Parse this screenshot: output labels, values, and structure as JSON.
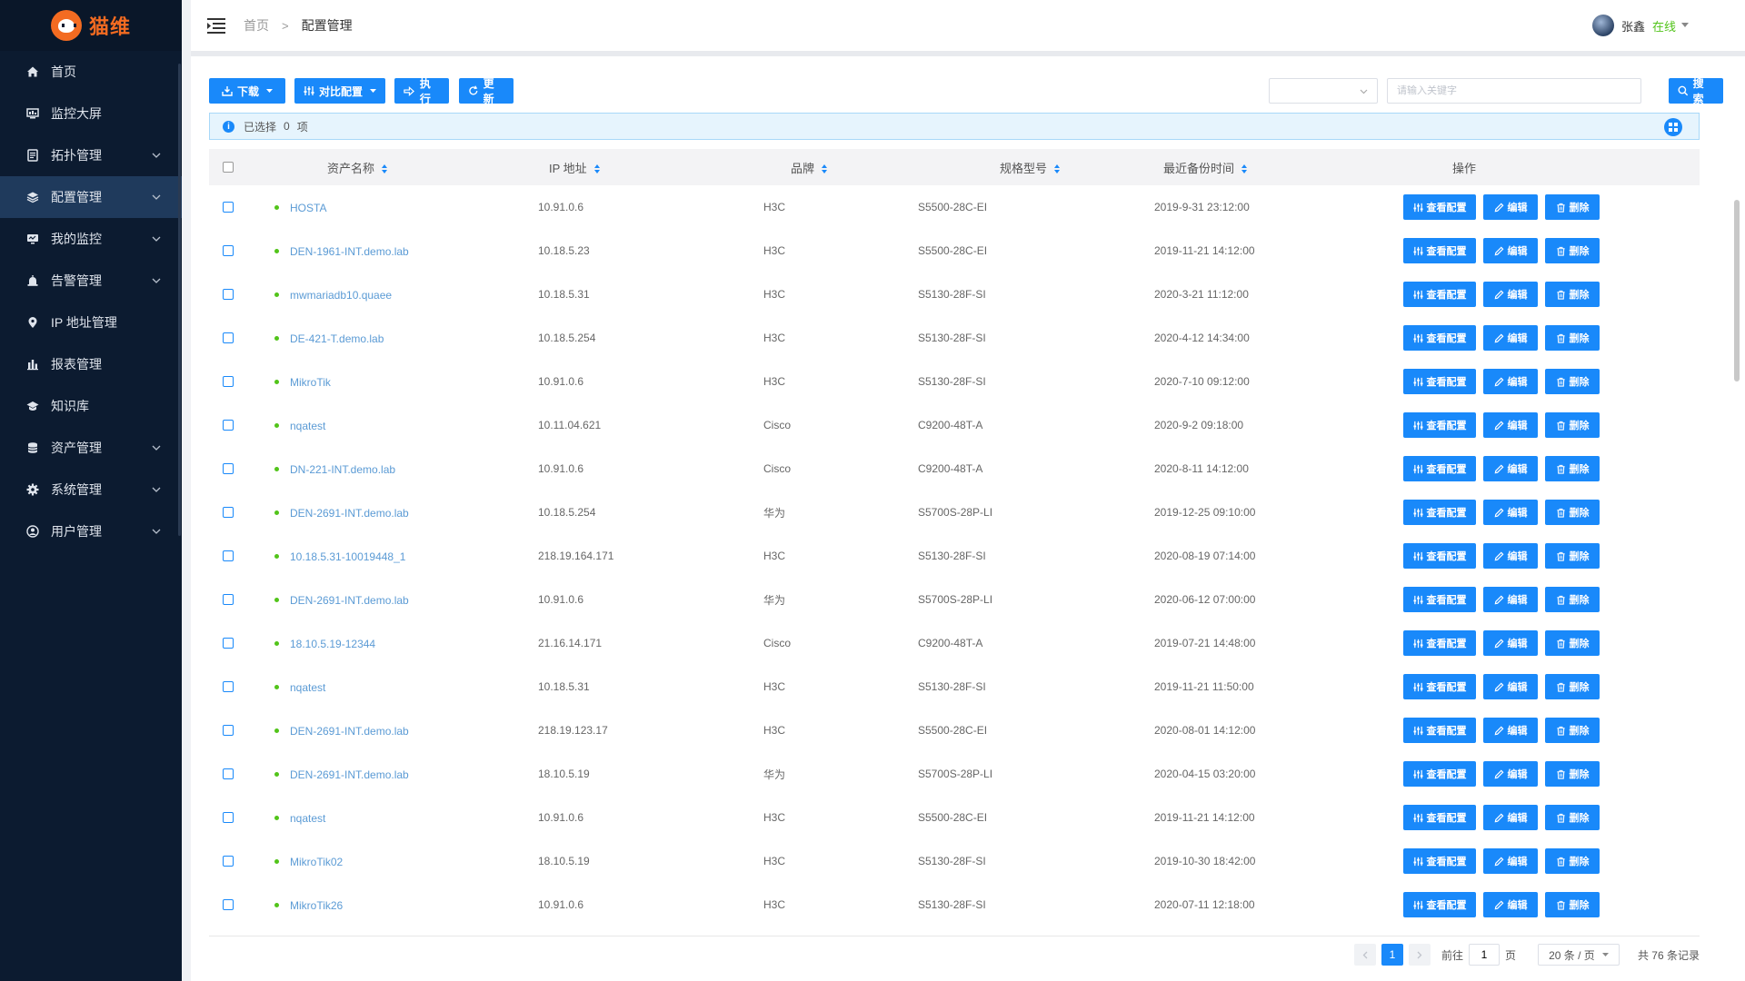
{
  "app": {
    "logo_text": "猫维"
  },
  "sidebar": {
    "items": [
      {
        "label": "首页",
        "icon": "home-icon",
        "expandable": false,
        "active": false
      },
      {
        "label": "监控大屏",
        "icon": "monitor-screen-icon",
        "expandable": false,
        "active": false
      },
      {
        "label": "拓扑管理",
        "icon": "topology-icon",
        "expandable": true,
        "active": false
      },
      {
        "label": "配置管理",
        "icon": "layers-icon",
        "expandable": true,
        "active": true
      },
      {
        "label": "我的监控",
        "icon": "monitor-icon",
        "expandable": true,
        "active": false
      },
      {
        "label": "告警管理",
        "icon": "alarm-icon",
        "expandable": true,
        "active": false
      },
      {
        "label": "IP 地址管理",
        "icon": "location-pin-icon",
        "expandable": false,
        "active": false
      },
      {
        "label": "报表管理",
        "icon": "bar-chart-icon",
        "expandable": false,
        "active": false
      },
      {
        "label": "知识库",
        "icon": "graduation-cap-icon",
        "expandable": false,
        "active": false
      },
      {
        "label": "资产管理",
        "icon": "database-icon",
        "expandable": true,
        "active": false
      },
      {
        "label": "系统管理",
        "icon": "gear-icon",
        "expandable": true,
        "active": false
      },
      {
        "label": "用户管理",
        "icon": "user-icon",
        "expandable": true,
        "active": false
      }
    ]
  },
  "header": {
    "breadcrumb": {
      "home": "首页",
      "separator": ">",
      "current": "配置管理"
    },
    "user": {
      "name": "张鑫",
      "status": "在线"
    }
  },
  "toolbar": {
    "download_label": "下载",
    "compare_label": "对比配置",
    "execute_label": "执行",
    "refresh_label": "更新",
    "search_placeholder": "请输入关键字",
    "search_label": "搜索"
  },
  "selection": {
    "prefix": "已选择",
    "count": "0",
    "suffix": "项"
  },
  "table": {
    "columns": {
      "name": "资产名称",
      "ip": "IP 地址",
      "brand": "品牌",
      "model": "规格型号",
      "backup_time": "最近备份时间",
      "ops": "操作"
    },
    "actions": {
      "view": "查看配置",
      "edit": "编辑",
      "delete": "删除"
    },
    "rows": [
      {
        "name": "HOSTA",
        "ip": "10.91.0.6",
        "brand": "H3C",
        "model": "S5500-28C-EI",
        "time": "2019-9-31 23:12:00"
      },
      {
        "name": "DEN-1961-INT.demo.lab",
        "ip": "10.18.5.23",
        "brand": "H3C",
        "model": "S5500-28C-EI",
        "time": "2019-11-21 14:12:00"
      },
      {
        "name": "mwmariadb10.quaee",
        "ip": "10.18.5.31",
        "brand": "H3C",
        "model": "S5130-28F-SI",
        "time": "2020-3-21 11:12:00"
      },
      {
        "name": "DE-421-T.demo.lab",
        "ip": "10.18.5.254",
        "brand": "H3C",
        "model": "S5130-28F-SI",
        "time": "2020-4-12 14:34:00"
      },
      {
        "name": "MikroTik",
        "ip": "10.91.0.6",
        "brand": "H3C",
        "model": "S5130-28F-SI",
        "time": "2020-7-10 09:12:00"
      },
      {
        "name": "nqatest",
        "ip": "10.11.04.621",
        "brand": "Cisco",
        "model": "C9200-48T-A",
        "time": "2020-9-2 09:18:00"
      },
      {
        "name": "DN-221-INT.demo.lab",
        "ip": "10.91.0.6",
        "brand": "Cisco",
        "model": "C9200-48T-A",
        "time": "2020-8-11 14:12:00"
      },
      {
        "name": "DEN-2691-INT.demo.lab",
        "ip": "10.18.5.254",
        "brand": "华为",
        "model": "S5700S-28P-LI",
        "time": "2019-12-25 09:10:00"
      },
      {
        "name": "10.18.5.31-10019448_1",
        "ip": "218.19.164.171",
        "brand": "H3C",
        "model": "S5130-28F-SI",
        "time": "2020-08-19 07:14:00"
      },
      {
        "name": "DEN-2691-INT.demo.lab",
        "ip": "10.91.0.6",
        "brand": "华为",
        "model": "S5700S-28P-LI",
        "time": "2020-06-12 07:00:00"
      },
      {
        "name": "18.10.5.19-12344",
        "ip": "21.16.14.171",
        "brand": "Cisco",
        "model": "C9200-48T-A",
        "time": "2019-07-21 14:48:00"
      },
      {
        "name": "nqatest",
        "ip": "10.18.5.31",
        "brand": "H3C",
        "model": "S5130-28F-SI",
        "time": "2019-11-21 11:50:00"
      },
      {
        "name": "DEN-2691-INT.demo.lab",
        "ip": "218.19.123.17",
        "brand": "H3C",
        "model": "S5500-28C-EI",
        "time": "2020-08-01 14:12:00"
      },
      {
        "name": "DEN-2691-INT.demo.lab",
        "ip": "18.10.5.19",
        "brand": "华为",
        "model": "S5700S-28P-LI",
        "time": "2020-04-15 03:20:00"
      },
      {
        "name": "nqatest",
        "ip": "10.91.0.6",
        "brand": "H3C",
        "model": "S5500-28C-EI",
        "time": "2019-11-21 14:12:00"
      },
      {
        "name": "MikroTik02",
        "ip": "18.10.5.19",
        "brand": "H3C",
        "model": "S5130-28F-SI",
        "time": "2019-10-30 18:42:00"
      },
      {
        "name": "MikroTik26",
        "ip": "10.91.0.6",
        "brand": "H3C",
        "model": "S5130-28F-SI",
        "time": "2020-07-11 12:18:00"
      }
    ]
  },
  "pagination": {
    "current_page": "1",
    "goto_prefix": "前往",
    "goto_value": "1",
    "goto_suffix": "页",
    "page_size": "20 条 / 页",
    "total": "共 76 条记录"
  },
  "colors": {
    "primary": "#1989fa",
    "sidebar_bg": "#0c1b30",
    "sidebar_active": "#1f3a5c",
    "logo": "#f36b21",
    "status_online": "#52c41a"
  }
}
